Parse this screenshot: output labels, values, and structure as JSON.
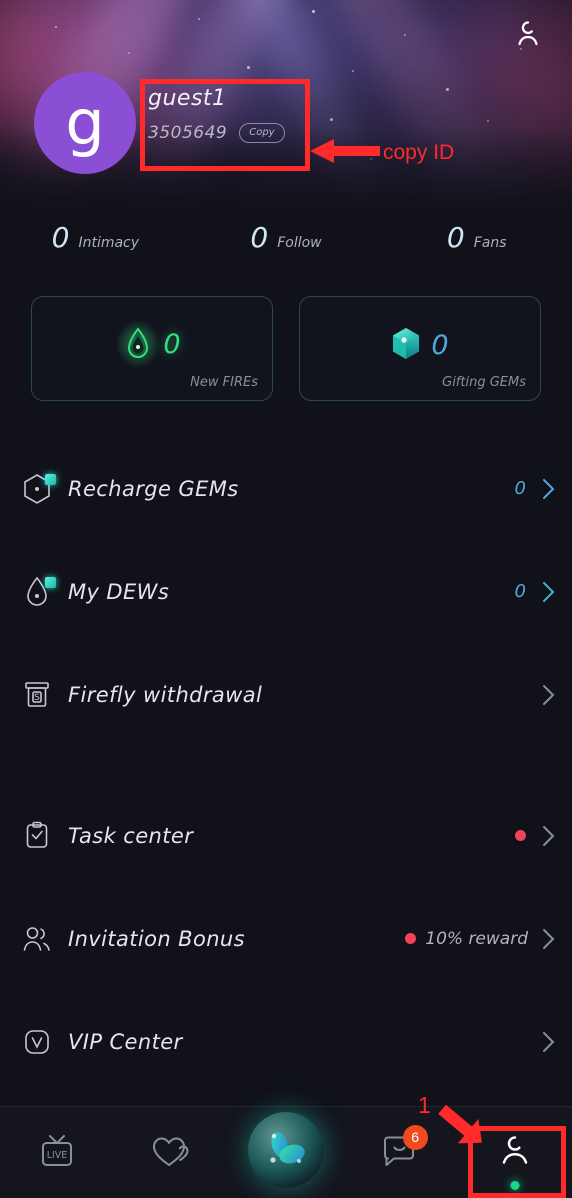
{
  "header": {
    "top_right_icon": "person-icon",
    "avatar_letter": "g",
    "username": "guest1",
    "user_id": "3505649",
    "copy_label": "Copy"
  },
  "annotations": {
    "copy_id_text": "copy ID",
    "nav_step_number": "1"
  },
  "stats": [
    {
      "value": "0",
      "label": "Intimacy"
    },
    {
      "value": "0",
      "label": "Follow"
    },
    {
      "value": "0",
      "label": "Fans"
    }
  ],
  "cards": [
    {
      "icon": "flame-icon",
      "value": "0",
      "caption": "New FIREs",
      "color": "#2fe07f"
    },
    {
      "icon": "gem-icon",
      "value": "0",
      "caption": "Gifting GEMs",
      "color": "#4fa9d8"
    }
  ],
  "menu": [
    {
      "icon": "hexagon-gem-icon",
      "label": "Recharge GEMs",
      "value": "0",
      "badge": false,
      "extra": ""
    },
    {
      "icon": "droplet-icon",
      "label": "My DEWs",
      "value": "0",
      "badge": false,
      "extra": ""
    },
    {
      "icon": "atm-withdraw-icon",
      "label": "Firefly withdrawal",
      "value": "",
      "badge": false,
      "extra": ""
    },
    {
      "icon": "clipboard-check-icon",
      "label": "Task center",
      "value": "",
      "badge": true,
      "extra": ""
    },
    {
      "icon": "two-people-icon",
      "label": "Invitation Bonus",
      "value": "",
      "badge": true,
      "extra": "10% reward"
    },
    {
      "icon": "vip-icon",
      "label": "VIP Center",
      "value": "",
      "badge": false,
      "extra": ""
    }
  ],
  "bottom_nav": [
    {
      "icon": "live-tv-icon",
      "label": "LIVE",
      "badge": "",
      "active": false
    },
    {
      "icon": "double-heart-icon",
      "label": "",
      "badge": "",
      "active": false
    },
    {
      "icon": "butterfly-orb-icon",
      "label": "",
      "badge": "",
      "active": false
    },
    {
      "icon": "chat-bubble-icon",
      "label": "",
      "badge": "6",
      "active": false
    },
    {
      "icon": "profile-person-icon",
      "label": "",
      "badge": "",
      "active": true
    }
  ],
  "colors": {
    "accent_green": "#2fe07f",
    "accent_blue": "#4fa9d8",
    "accent_teal": "#17b8a6",
    "badge_red": "#f4425a",
    "badge_orange": "#f04a1e",
    "annotation_red": "#ff2a2a",
    "avatar_purple": "#8b4fd6",
    "background": "#101119"
  }
}
